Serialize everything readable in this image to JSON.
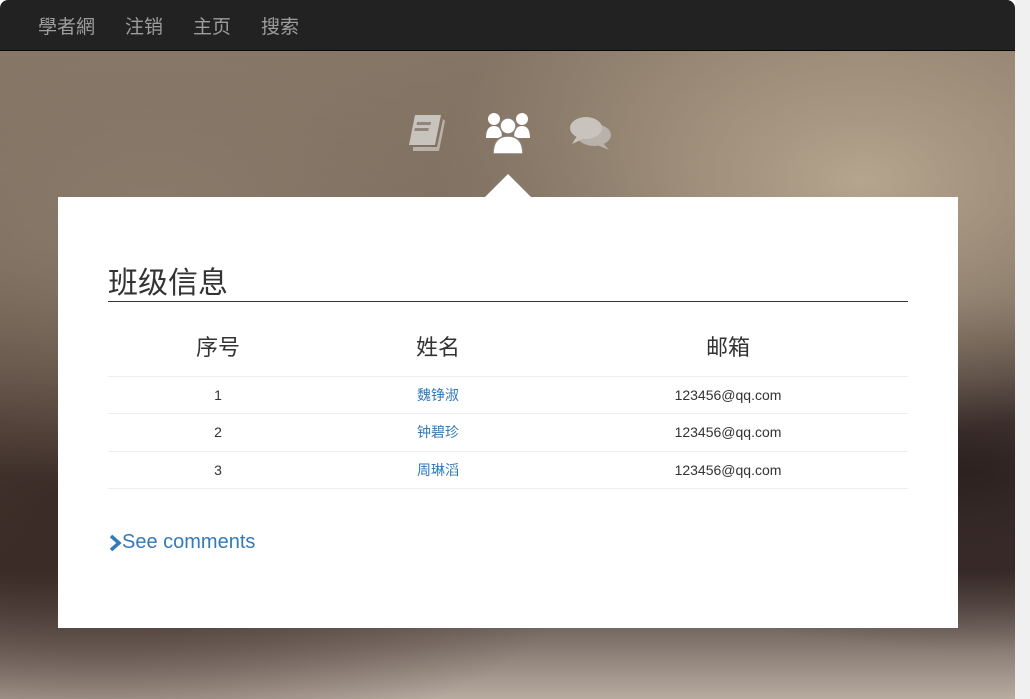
{
  "nav": {
    "brand": "學者網",
    "items": [
      "注销",
      "主页",
      "搜索"
    ]
  },
  "tabs": [
    {
      "icon": "book-icon"
    },
    {
      "icon": "users-icon",
      "active": true
    },
    {
      "icon": "comments-icon"
    }
  ],
  "section_title": "班级信息",
  "table": {
    "headers": [
      "序号",
      "姓名",
      "邮箱"
    ],
    "rows": [
      [
        "1",
        "魏铮淑",
        "123456@qq.com"
      ],
      [
        "2",
        "钟碧珍",
        "123456@qq.com"
      ],
      [
        "3",
        "周琳滔",
        "123456@qq.com"
      ]
    ]
  },
  "see_comments": "See comments"
}
